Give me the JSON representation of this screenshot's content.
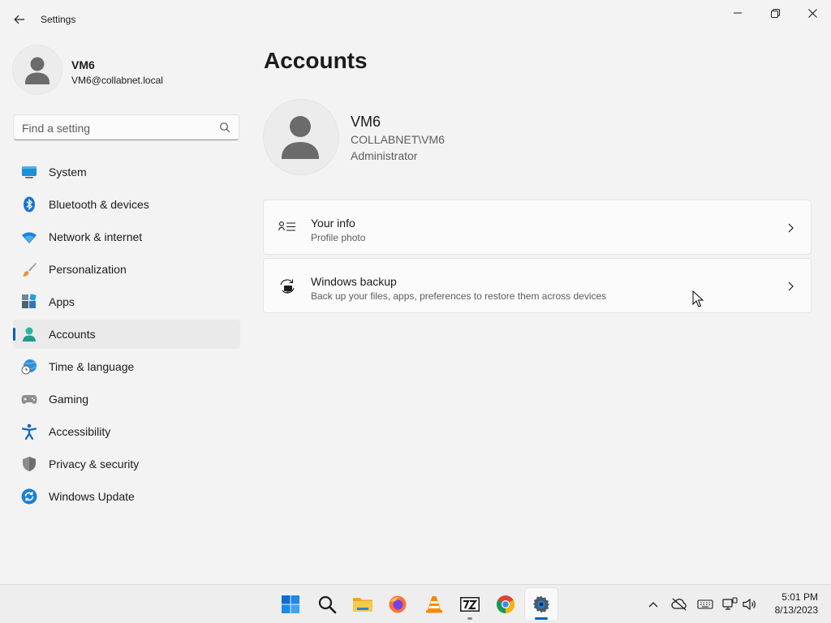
{
  "window": {
    "app_title": "Settings"
  },
  "user": {
    "name": "VM6",
    "email": "VM6@collabnet.local"
  },
  "search": {
    "placeholder": "Find a setting",
    "value": ""
  },
  "sidebar": {
    "items": [
      {
        "label": "System",
        "icon": "system-icon",
        "active": false
      },
      {
        "label": "Bluetooth & devices",
        "icon": "bluetooth-icon",
        "active": false
      },
      {
        "label": "Network & internet",
        "icon": "wifi-icon",
        "active": false
      },
      {
        "label": "Personalization",
        "icon": "brush-icon",
        "active": false
      },
      {
        "label": "Apps",
        "icon": "apps-icon",
        "active": false
      },
      {
        "label": "Accounts",
        "icon": "accounts-icon",
        "active": true
      },
      {
        "label": "Time & language",
        "icon": "time-language-icon",
        "active": false
      },
      {
        "label": "Gaming",
        "icon": "gamepad-icon",
        "active": false
      },
      {
        "label": "Accessibility",
        "icon": "accessibility-icon",
        "active": false
      },
      {
        "label": "Privacy & security",
        "icon": "shield-icon",
        "active": false
      },
      {
        "label": "Windows Update",
        "icon": "update-icon",
        "active": false
      }
    ]
  },
  "main": {
    "title": "Accounts",
    "account": {
      "name": "VM6",
      "domain": "COLLABNET\\VM6",
      "role": "Administrator"
    },
    "cards": [
      {
        "title": "Your info",
        "subtitle": "Profile photo",
        "icon": "your-info-icon"
      },
      {
        "title": "Windows backup",
        "subtitle": "Back up your files, apps, preferences to restore them across devices",
        "icon": "backup-icon"
      }
    ]
  },
  "taskbar": {
    "apps": [
      "start-icon",
      "search-icon",
      "file-explorer-icon",
      "firefox-icon",
      "vlc-icon",
      "7zip-icon",
      "chrome-icon",
      "settings-icon"
    ],
    "tray": [
      "chevron-up-icon",
      "onedrive-offline-icon",
      "keyboard-icon",
      "network-icon",
      "volume-icon"
    ],
    "time": "5:01 PM",
    "date": "8/13/2023"
  },
  "colors": {
    "accent": "#005fb8",
    "background": "#f3f3f3",
    "card": "#fbfbfb"
  }
}
